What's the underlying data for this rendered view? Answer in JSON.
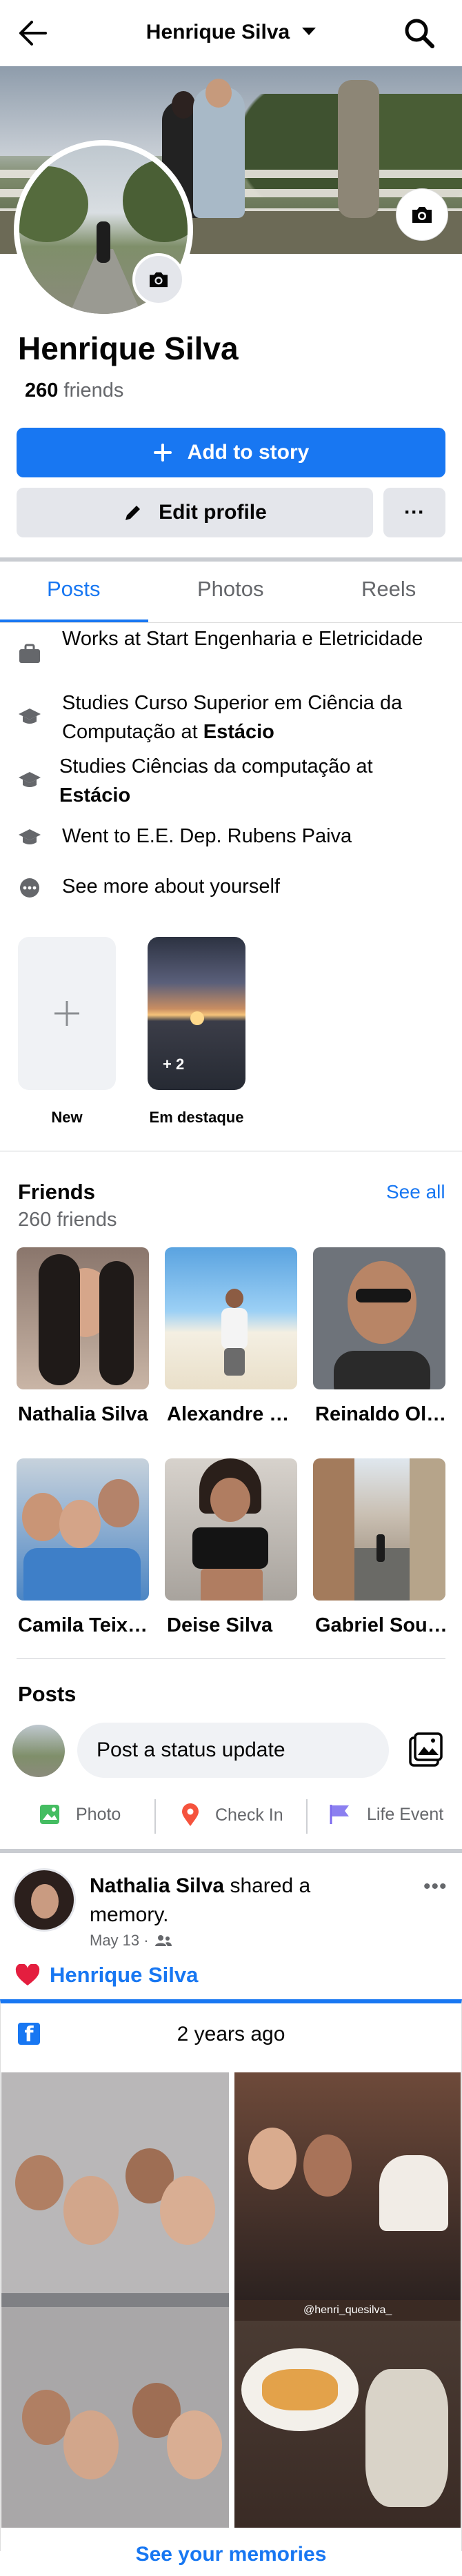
{
  "header": {
    "title": "Henrique Silva"
  },
  "profile": {
    "name": "Henrique Silva",
    "friends_count": "260",
    "friends_label": "friends"
  },
  "buttons": {
    "add_story": "Add to story",
    "edit_profile": "Edit profile",
    "more": "···"
  },
  "tabs": [
    "Posts",
    "Photos",
    "Reels"
  ],
  "intro": {
    "work": "Works at Start Engenharia e Eletricidade",
    "edu1_prefix": "Studies Curso Superior em Ciência da Computação at",
    "edu1_school": "Estácio",
    "edu2_prefix": "Studies Ciências da computação at",
    "edu2_school": "Estácio",
    "school": "Went to E.E. Dep. Rubens Paiva",
    "see_more": "See more about yourself"
  },
  "highlights": {
    "new_label": "New",
    "featured_label": "Em destaque",
    "featured_count": "+ 2"
  },
  "friends": {
    "title": "Friends",
    "count": "260 friends",
    "see_all": "See all",
    "list": [
      "Nathalia Silva",
      "Alexandre Santos",
      "Reinaldo Oliveira",
      "Camila Teixeira",
      "Deise Silva",
      "Gabriel Souza"
    ]
  },
  "posts": {
    "title": "Posts",
    "composer_placeholder": "Post a status update",
    "actions": [
      "Photo",
      "Check In",
      "Life Event"
    ]
  },
  "memory_post": {
    "author": "Nathalia Silva",
    "action": "shared a memory.",
    "date": "May 13 ·",
    "tagged": "Henrique Silva",
    "years_ago": "2 years ago",
    "overlay_handle": "@henri_quesilva_",
    "see_memories": "See your memories"
  },
  "colors": {
    "primary": "#1877f2",
    "secondary_button": "#e4e6eb",
    "muted_text": "#65676b",
    "heart": "#e41e3f"
  }
}
